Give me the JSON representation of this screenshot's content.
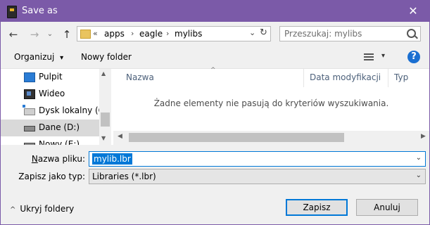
{
  "window": {
    "title": "Save as",
    "close_glyph": "✕"
  },
  "nav": {
    "back_glyph": "←",
    "forward_glyph": "→",
    "dropdown_glyph": "⌄",
    "up_glyph": "↑",
    "breadcrumb_prefix": "«",
    "breadcrumb": [
      "apps",
      "eagle",
      "mylibs"
    ],
    "sep_glyph": "›",
    "addr_dropdown_glyph": "⌄",
    "refresh_glyph": "↻",
    "search_placeholder": "Przeszukaj: mylibs"
  },
  "toolbar": {
    "organize": "Organizuj",
    "organize_dd": "▾",
    "new_folder": "Nowy folder",
    "view_dd": "▾",
    "help": "?"
  },
  "tree": {
    "items": [
      {
        "label": "Pulpit",
        "icon": "desktop-icon"
      },
      {
        "label": "Wideo",
        "icon": "video-icon"
      },
      {
        "label": "Dysk lokalny (C:)",
        "icon": "local-disk-icon"
      },
      {
        "label": "Dane (D:)",
        "icon": "drive-icon",
        "selected": true
      },
      {
        "label": "Nowy (E:)",
        "icon": "drive-icon"
      }
    ],
    "scroll_up": "▲",
    "scroll_down": "▼"
  },
  "files": {
    "columns": [
      "Nazwa",
      "Data modyfikacji",
      "Typ"
    ],
    "sort_glyph": "^",
    "empty_message": "Żadne elementy nie pasują do kryteriów wyszukiwania.",
    "scroll_left": "◀",
    "scroll_right": "▶"
  },
  "form": {
    "filename_label": "Nazwa pliku:",
    "filename_value": "mylib.lbr",
    "filetype_label": "Zapisz jako typ:",
    "filetype_value": "Libraries (*.lbr)",
    "dropdown_glyph": "⌄"
  },
  "footer": {
    "hide_folders_glyph": "^",
    "hide_folders": "Ukryj foldery",
    "save": "Zapisz",
    "cancel": "Anuluj"
  },
  "colors": {
    "titlebar": "#7b5aa8",
    "accent": "#0078d7"
  }
}
